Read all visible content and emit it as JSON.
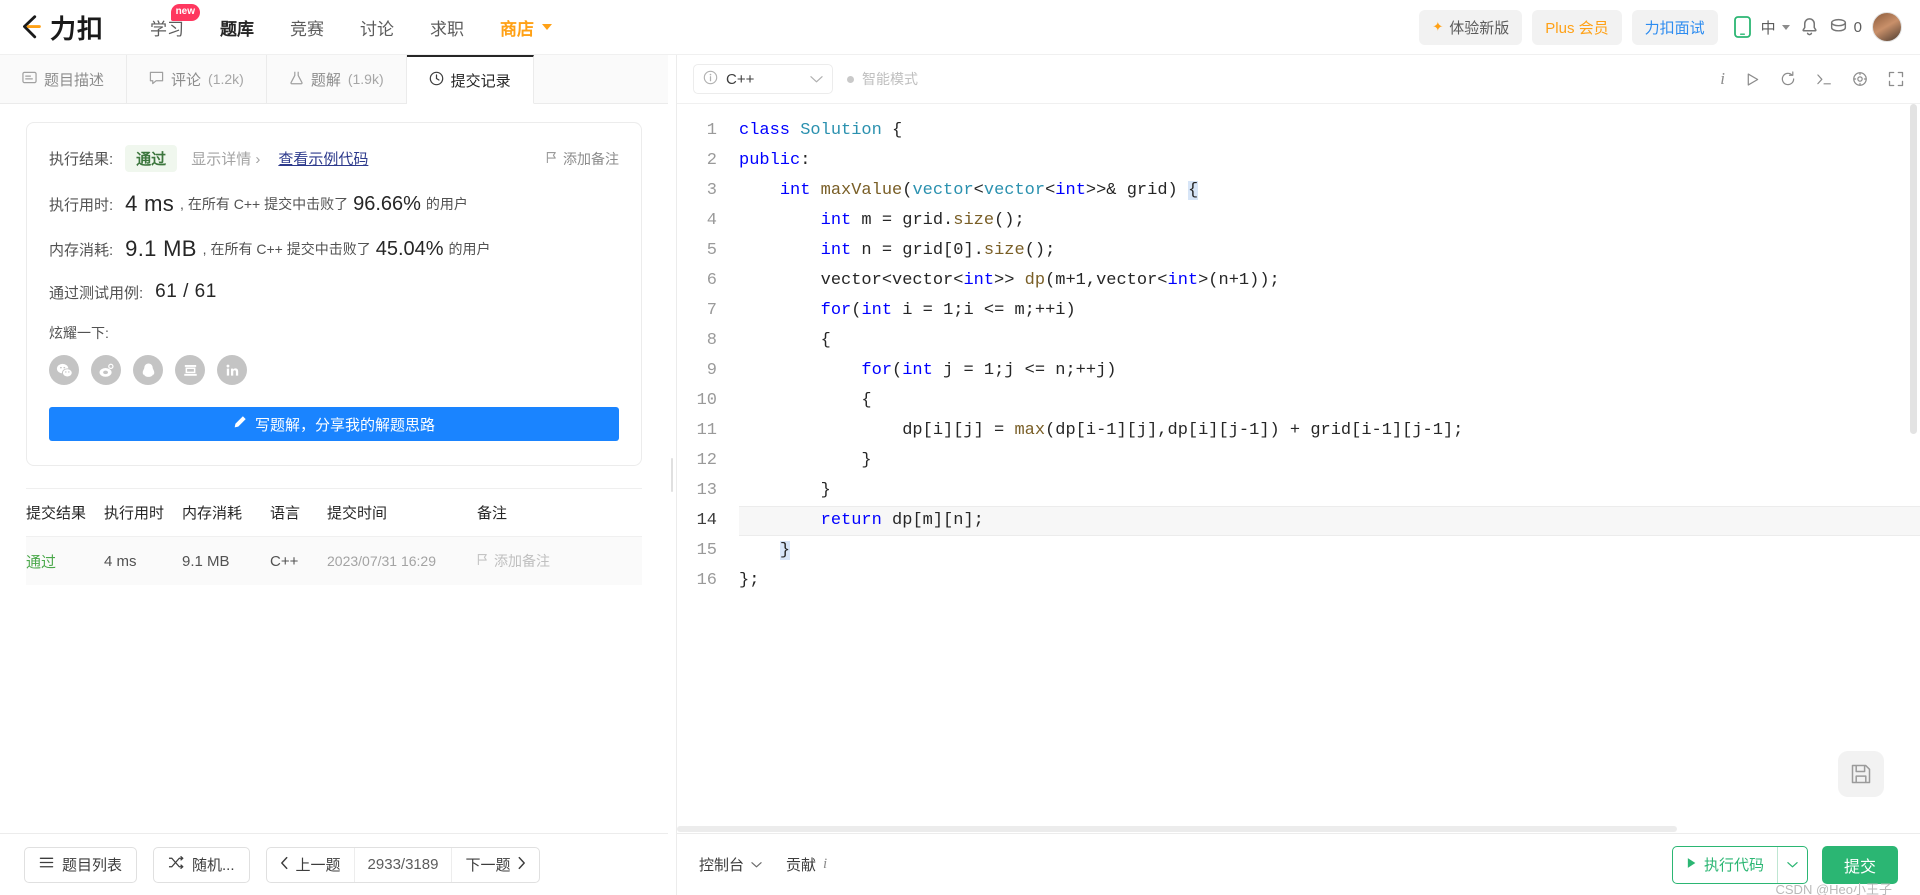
{
  "header": {
    "logo_text": "力扣",
    "nav": [
      {
        "label": "学习",
        "badge": "new",
        "active": false
      },
      {
        "label": "题库",
        "badge": "",
        "active": true
      },
      {
        "label": "竞赛",
        "badge": "",
        "active": false
      },
      {
        "label": "讨论",
        "badge": "",
        "active": false
      },
      {
        "label": "求职",
        "badge": "",
        "active": false
      }
    ],
    "shop_label": "商店",
    "try_new_label": "体验新版",
    "plus_label": "Plus 会员",
    "interview_label": "力扣面试",
    "lang_label": "中",
    "coin_count": "0",
    "icons": {
      "mobile": "mobile-icon",
      "bell": "bell-icon",
      "coin": "coin-icon",
      "avatar": "avatar"
    },
    "colors": {
      "accent_orange": "#ffa116",
      "link_blue": "#2d8cf0",
      "green": "#2bb673"
    }
  },
  "left_tabs": [
    {
      "label": "题目描述",
      "count": "",
      "icon": "description-icon",
      "active": false
    },
    {
      "label": "评论",
      "count": "(1.2k)",
      "icon": "comment-icon",
      "active": false
    },
    {
      "label": "题解",
      "count": "(1.9k)",
      "icon": "flask-icon",
      "active": false
    },
    {
      "label": "提交记录",
      "count": "",
      "icon": "clock-icon",
      "active": true
    }
  ],
  "result": {
    "result_label": "执行结果:",
    "status": "通过",
    "show_detail": "显示详情 ›",
    "view_sample_code": "查看示例代码",
    "add_note": "添加备注",
    "runtime_label": "执行用时:",
    "runtime_value": "4 ms",
    "runtime_prefix": ", 在所有 C++ 提交中击败了",
    "runtime_pct": "96.66%",
    "runtime_suffix": "的用户",
    "memory_label": "内存消耗:",
    "memory_value": "9.1 MB",
    "memory_prefix": ", 在所有 C++ 提交中击败了",
    "memory_pct": "45.04%",
    "memory_suffix": "的用户",
    "cases_label": "通过测试用例:",
    "cases_value": "61 / 61",
    "brag_label": "炫耀一下:",
    "share_icons": [
      "wechat-icon",
      "weibo-icon",
      "qq-icon",
      "douban-icon",
      "linkedin-icon"
    ],
    "write_solution": "写题解，分享我的解题思路"
  },
  "submissions": {
    "columns": [
      "提交结果",
      "执行用时",
      "内存消耗",
      "语言",
      "提交时间",
      "备注"
    ],
    "rows": [
      {
        "status": "通过",
        "runtime": "4 ms",
        "memory": "9.1 MB",
        "language": "C++",
        "time": "2023/07/31 16:29",
        "note": "添加备注"
      }
    ]
  },
  "left_footer": {
    "problem_list": "题目列表",
    "random": "随机...",
    "prev": "上一题",
    "counter": "2933/3189",
    "next": "下一题"
  },
  "editor": {
    "language": "C++",
    "smart_mode": "智能模式",
    "toolbar_icons": [
      "info-icon",
      "play-icon",
      "reset-icon",
      "console-icon",
      "settings-icon",
      "fullscreen-icon"
    ],
    "save_icon": "save-icon",
    "lines": [
      {
        "n": "1",
        "html": "<span class=\"kw\">class</span> <span class=\"ty\">Solution</span> {"
      },
      {
        "n": "2",
        "html": "<span class=\"kw\">public</span>:"
      },
      {
        "n": "3",
        "html": "    <span class=\"kw\">int</span> <span class=\"fn\">maxValue</span>(<span class=\"ty\">vector</span>&lt;<span class=\"ty\">vector</span>&lt;<span class=\"kw\">int</span>&gt;&gt;&amp; grid) <span class=\"brk-hl\">{</span>"
      },
      {
        "n": "4",
        "html": "        <span class=\"kw\">int</span> m = grid.<span class=\"fn\">size</span>();"
      },
      {
        "n": "5",
        "html": "        <span class=\"kw\">int</span> n = grid[<span class=\"pl\">0</span>].<span class=\"fn\">size</span>();"
      },
      {
        "n": "6",
        "html": "        vector&lt;vector&lt;<span class=\"kw\">int</span>&gt;&gt; <span class=\"fn\">dp</span>(m+<span class=\"pl\">1</span>,vector&lt;<span class=\"kw\">int</span>&gt;(n+<span class=\"pl\">1</span>));"
      },
      {
        "n": "7",
        "html": "        <span class=\"kw\">for</span>(<span class=\"kw\">int</span> i = <span class=\"pl\">1</span>;i &lt;= m;++i)"
      },
      {
        "n": "8",
        "html": "        {"
      },
      {
        "n": "9",
        "html": "            <span class=\"kw\">for</span>(<span class=\"kw\">int</span> j = <span class=\"pl\">1</span>;j &lt;= n;++j)"
      },
      {
        "n": "10",
        "html": "            {"
      },
      {
        "n": "11",
        "html": "                dp[i][j] = <span class=\"fn\">max</span>(dp[i-<span class=\"pl\">1</span>][j],dp[i][j-<span class=\"pl\">1</span>]) + grid[i-<span class=\"pl\">1</span>][j-<span class=\"pl\">1</span>];"
      },
      {
        "n": "12",
        "html": "            }"
      },
      {
        "n": "13",
        "html": "        }"
      },
      {
        "n": "14",
        "html": "        <span class=\"kw\">return</span> dp[m][n];",
        "highlight": true
      },
      {
        "n": "15",
        "html": "    <span class=\"brk-hl\">}</span>"
      },
      {
        "n": "16",
        "html": "};"
      }
    ]
  },
  "right_footer": {
    "console": "控制台",
    "contribute": "贡献",
    "run_code": "执行代码",
    "submit": "提交"
  },
  "watermark": "CSDN @Heo小王子"
}
